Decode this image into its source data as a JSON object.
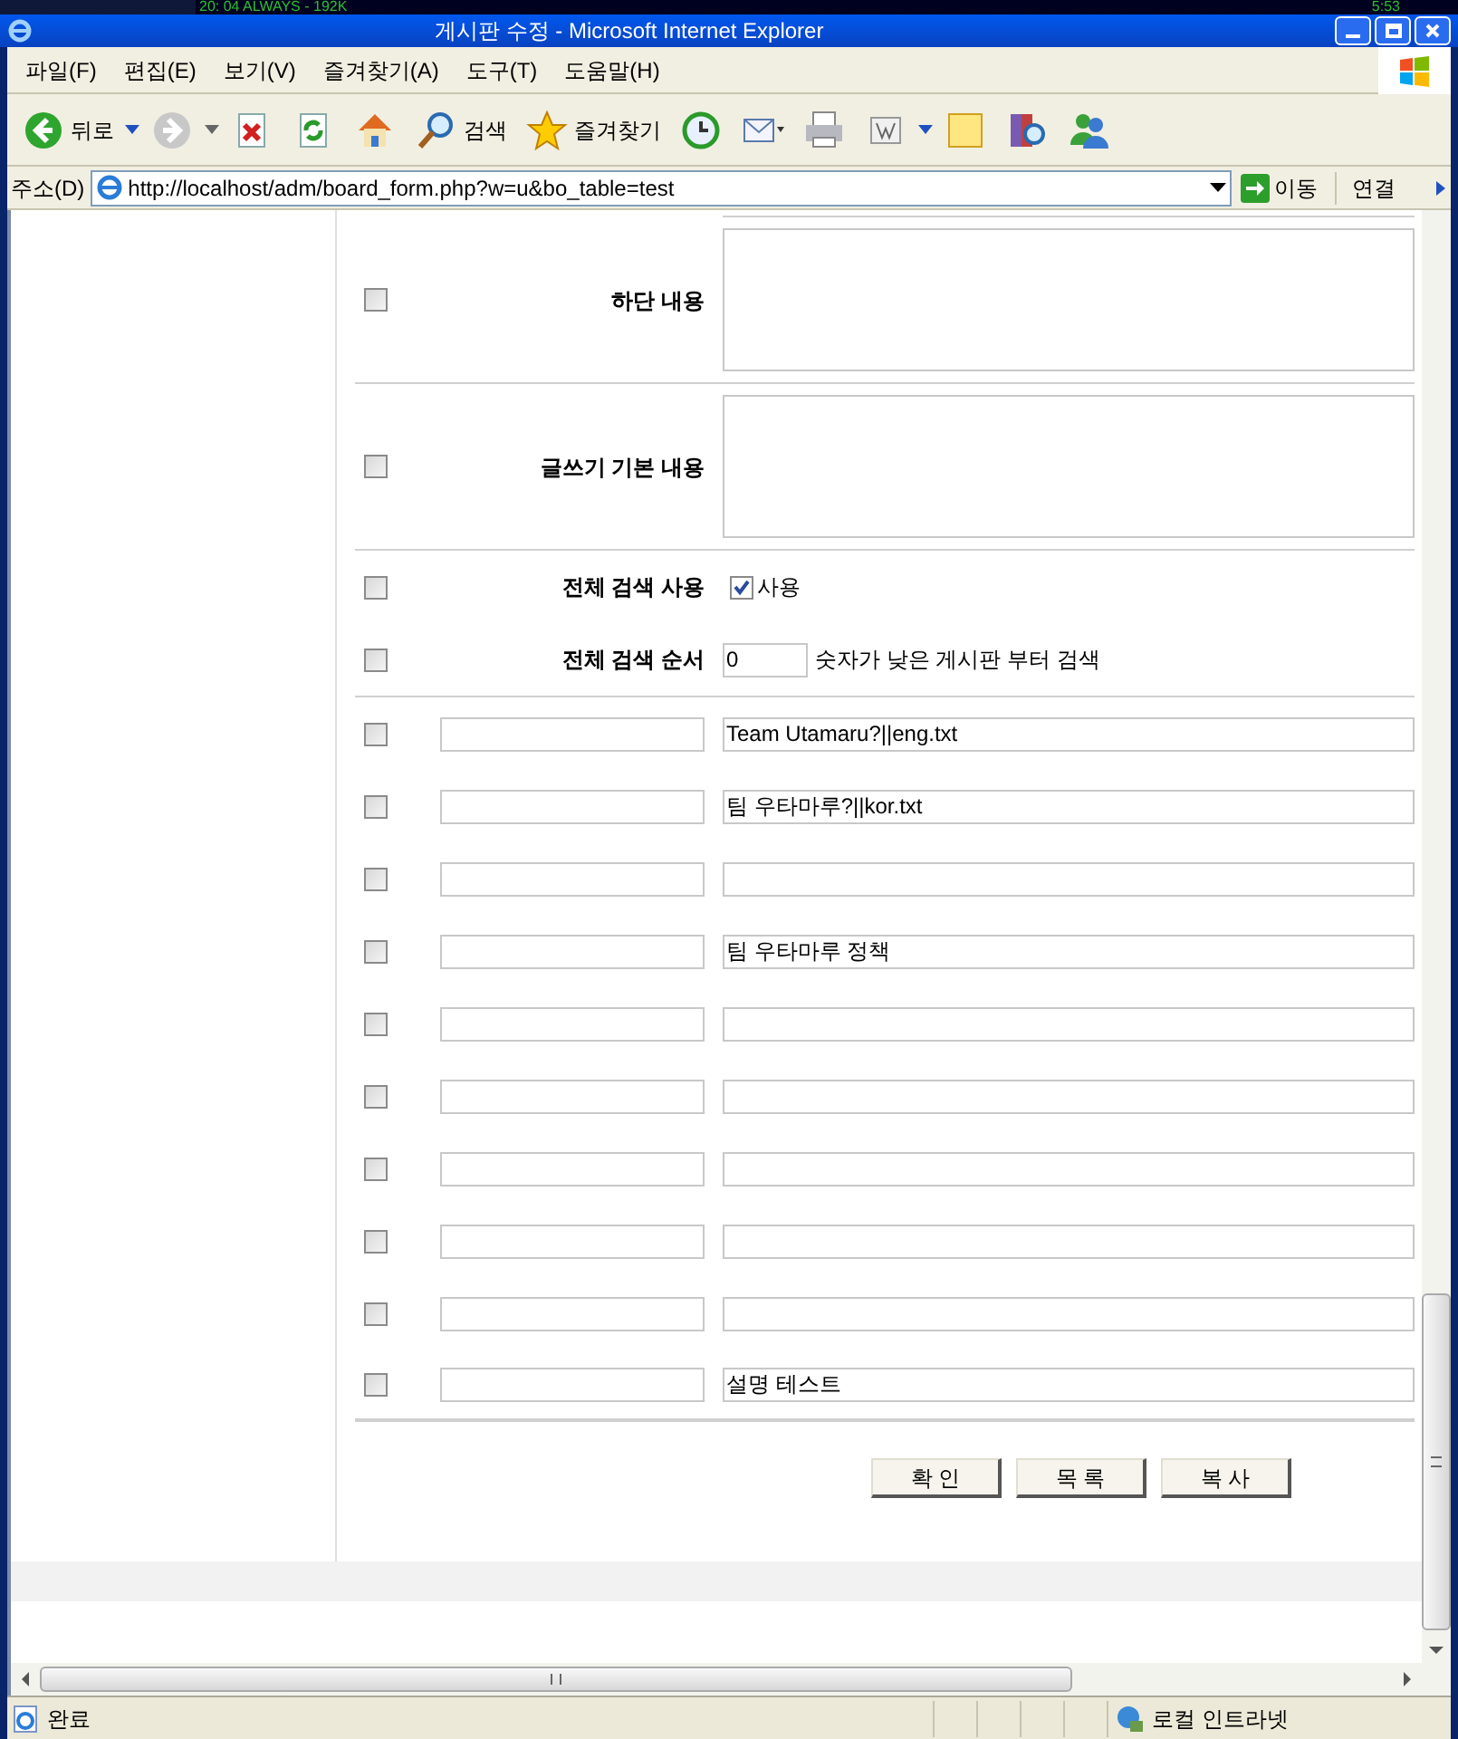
{
  "overlay_strip": {
    "track": "20: 04 ALWAYS - 192K",
    "time": "5:53"
  },
  "window": {
    "title": "게시판 수정 - Microsoft Internet Explorer"
  },
  "menu": [
    "파일(F)",
    "편집(E)",
    "보기(V)",
    "즐겨찾기(A)",
    "도구(T)",
    "도움말(H)"
  ],
  "toolbar": [
    {
      "kind": "back",
      "label": "뒤로"
    },
    {
      "kind": "forward"
    },
    {
      "kind": "stop"
    },
    {
      "kind": "refresh"
    },
    {
      "kind": "home"
    },
    {
      "kind": "search",
      "label": "검색"
    },
    {
      "kind": "favorites",
      "label": "즐겨찾기"
    },
    {
      "kind": "history"
    },
    {
      "kind": "mail"
    },
    {
      "kind": "print"
    },
    {
      "kind": "edit"
    },
    {
      "kind": "note"
    },
    {
      "kind": "research"
    },
    {
      "kind": "messenger"
    }
  ],
  "address_bar": {
    "label": "주소(D)",
    "url": "http://localhost/adm/board_form.php?w=u&bo_table=test",
    "go": "이동",
    "links": "연결"
  },
  "form": {
    "text_rows": [
      {
        "label": "하단 내용",
        "checked": false
      },
      {
        "label": "글쓰기 기본 내용",
        "checked": false
      }
    ],
    "search_use": {
      "label": "전체 검색 사용",
      "checked": false,
      "option_label": "사용",
      "option_checked": true
    },
    "search_order": {
      "label": "전체 검색 순서",
      "checked": false,
      "value": "0",
      "hint": "숫자가 낮은 게시판 부터 검색"
    },
    "extra_fields": [
      {
        "checked": false,
        "value": "Team Utamaru?||eng.txt"
      },
      {
        "checked": false,
        "value": "팀 우타마루?||kor.txt"
      },
      {
        "checked": false
      },
      {
        "checked": false,
        "value": "팀 우타마루 정책"
      },
      {
        "checked": false
      },
      {
        "checked": false
      },
      {
        "checked": false
      },
      {
        "checked": false
      },
      {
        "checked": false
      },
      {
        "checked": false,
        "value": "설명 테스트"
      }
    ],
    "buttons": [
      "확 인",
      "목 록",
      "복 사"
    ]
  },
  "status_bar": {
    "text": "완료",
    "zone": "로컬 인트라넷"
  }
}
